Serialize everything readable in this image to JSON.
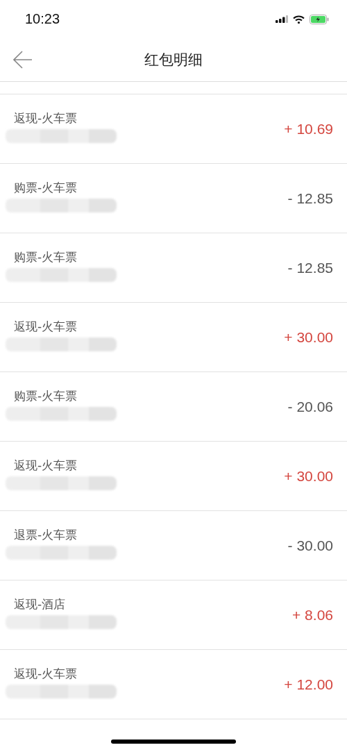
{
  "status_bar": {
    "time": "10:23"
  },
  "nav": {
    "title": "红包明细"
  },
  "records": [
    {
      "title": "返现-火车票",
      "amount": "+ 10.69",
      "kind": "income"
    },
    {
      "title": "购票-火车票",
      "amount": "- 12.85",
      "kind": "expense"
    },
    {
      "title": "购票-火车票",
      "amount": "- 12.85",
      "kind": "expense"
    },
    {
      "title": "返现-火车票",
      "amount": "+ 30.00",
      "kind": "income"
    },
    {
      "title": "购票-火车票",
      "amount": "- 20.06",
      "kind": "expense"
    },
    {
      "title": "返现-火车票",
      "amount": "+ 30.00",
      "kind": "income"
    },
    {
      "title": "退票-火车票",
      "amount": "- 30.00",
      "kind": "expense"
    },
    {
      "title": "返现-酒店",
      "amount": "+ 8.06",
      "kind": "income"
    },
    {
      "title": "返现-火车票",
      "amount": "+ 12.00",
      "kind": "income"
    }
  ]
}
